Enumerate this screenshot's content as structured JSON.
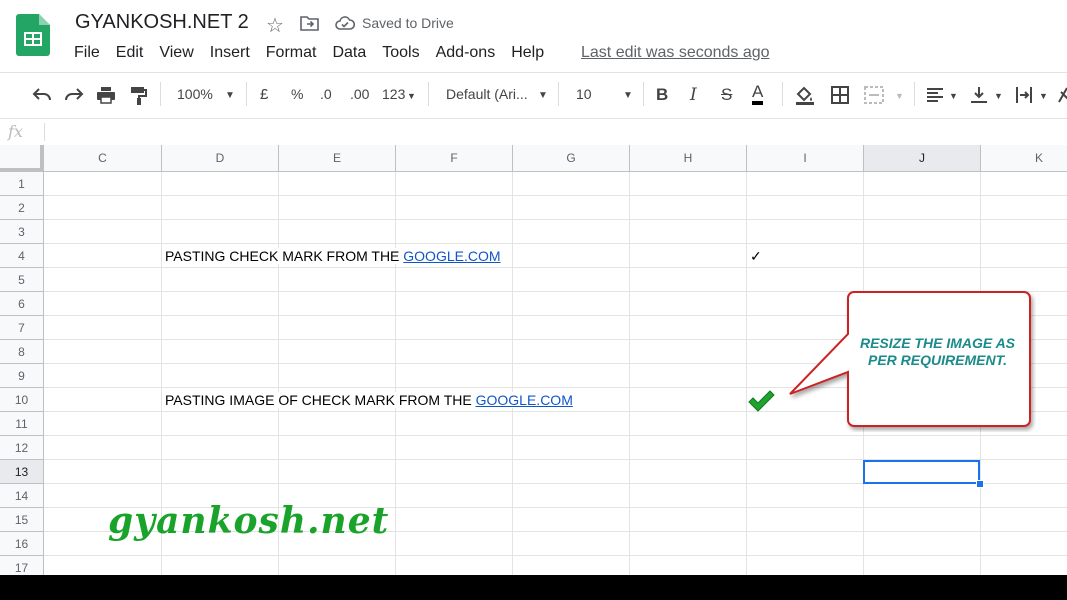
{
  "header": {
    "title": "GYANKOSH.NET 2",
    "saved_status": "Saved to Drive",
    "last_edit": "Last edit was seconds ago"
  },
  "menu": [
    "File",
    "Edit",
    "View",
    "Insert",
    "Format",
    "Data",
    "Tools",
    "Add-ons",
    "Help"
  ],
  "toolbar": {
    "zoom": "100%",
    "currency": "£",
    "percent": "%",
    "decimal_decrease": ".0",
    "decimal_increase": ".00",
    "more_formats": "123",
    "font": "Default (Ari...",
    "font_size": "10"
  },
  "formula_bar": {
    "fx": "fx"
  },
  "columns": [
    "C",
    "D",
    "E",
    "F",
    "G",
    "H",
    "I",
    "J",
    "K"
  ],
  "rows": [
    "1",
    "2",
    "3",
    "4",
    "5",
    "6",
    "7",
    "8",
    "9",
    "10",
    "11",
    "12",
    "13",
    "14",
    "15",
    "16",
    "17"
  ],
  "selected_cell": {
    "column": "J",
    "row": "13"
  },
  "cells": {
    "d4_text": "PASTING CHECK MARK FROM THE ",
    "d4_link": "GOOGLE.COM",
    "i4_mark": "✓",
    "d10_text": "PASTING IMAGE OF CHECK MARK FROM THE ",
    "d10_link": "GOOGLE.COM"
  },
  "callout": {
    "line1": "RESIZE THE IMAGE AS",
    "line2": "PER REQUIREMENT."
  },
  "watermark": "gyankosh.net",
  "colors": {
    "accent": "#1a73e8",
    "link": "#1155cc",
    "callout_border": "#cc2222",
    "callout_text": "#1a8a8a",
    "watermark": "#1aa32a",
    "check_green": "#1fa22e"
  }
}
